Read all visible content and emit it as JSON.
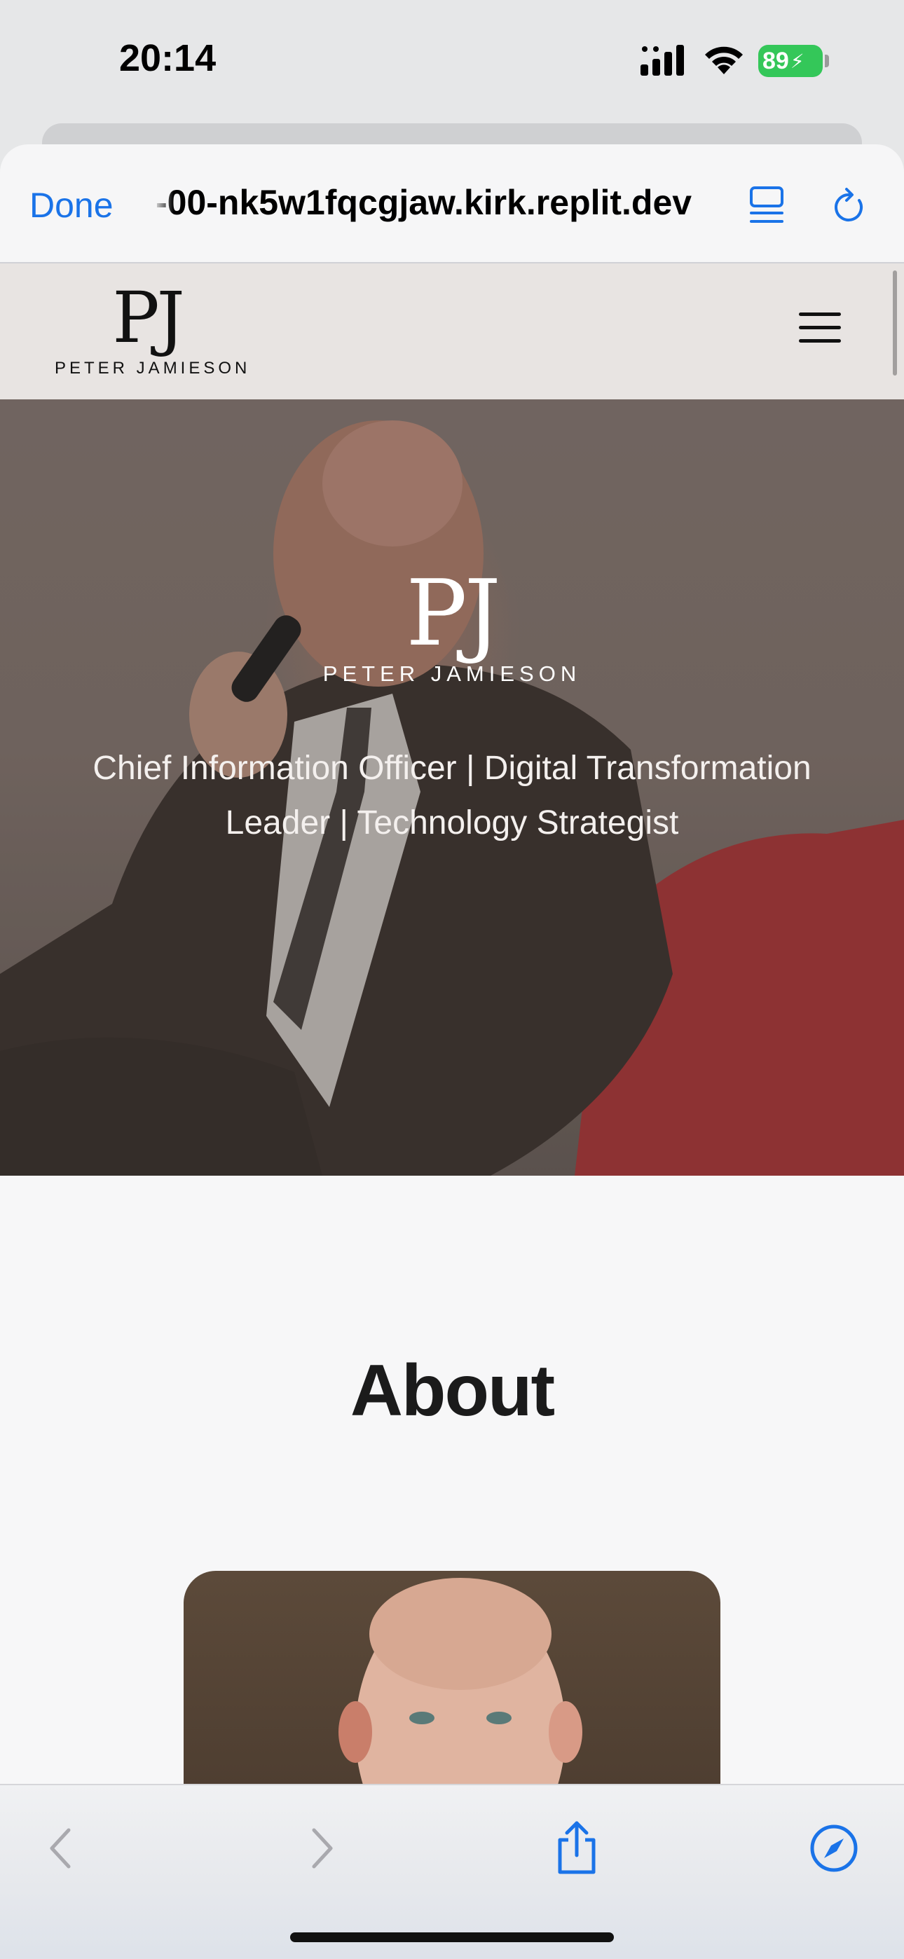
{
  "status_bar": {
    "time": "20:14",
    "battery": "89",
    "signal_icon": "cellular-signal-icon",
    "wifi_icon": "wifi-icon",
    "battery_color": "#34c759"
  },
  "browser": {
    "done_label": "Done",
    "url": "-00-nk5w1fqcgjaw.kirk.replit.dev",
    "accent": "#1a73e8"
  },
  "site": {
    "logo_mark": "PJ",
    "logo_name": "PETER JAMIESON",
    "hero_logo_mark": "PJ",
    "hero_logo_name": "PETER JAMIESON",
    "hero_tagline": "Chief Information Officer | Digital Transformation Leader | Technology Strategist",
    "about_title": "About"
  },
  "toolbar": {
    "back_icon": "chevron-left-icon",
    "forward_icon": "chevron-right-icon",
    "share_icon": "share-icon",
    "safari_icon": "compass-icon"
  }
}
